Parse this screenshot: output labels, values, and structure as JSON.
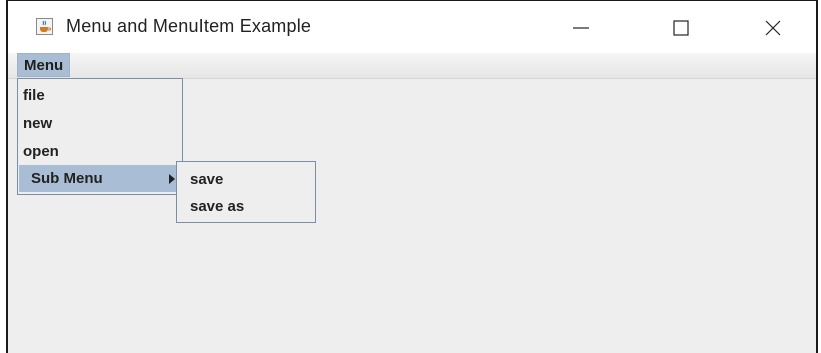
{
  "window": {
    "title": "Menu and MenuItem Example",
    "icon": "java-cup-icon",
    "controls": {
      "minimize": "minimize-icon",
      "maximize": "maximize-icon",
      "close": "close-icon"
    }
  },
  "menubar": {
    "menu_label": "Menu"
  },
  "menu": {
    "items": [
      {
        "label": "file"
      },
      {
        "label": "new"
      },
      {
        "label": "open"
      },
      {
        "label": "Sub Menu",
        "selected": true,
        "has_submenu": true
      }
    ],
    "submenu": {
      "items": [
        {
          "label": "save"
        },
        {
          "label": "save as"
        }
      ]
    }
  },
  "colors": {
    "selection": "#a9bed4",
    "background": "#eeeeee",
    "popup_border": "#7a8ea6"
  }
}
